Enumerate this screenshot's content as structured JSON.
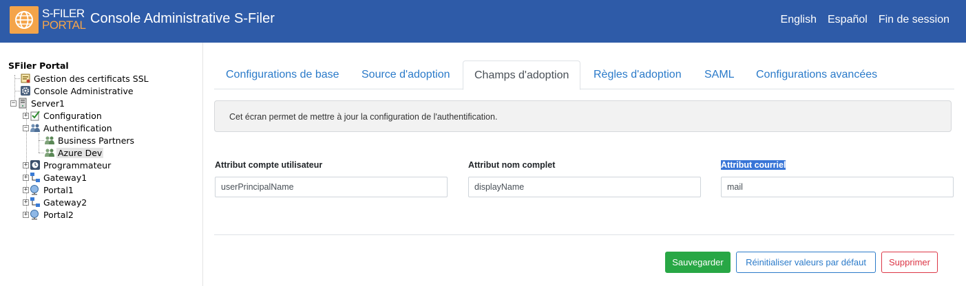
{
  "header": {
    "logo_line1": "S-FILER",
    "logo_line2": "PORTAL",
    "title": "Console Administrative S-Filer",
    "nav": [
      "English",
      "Español",
      "Fin de session"
    ],
    "colors": {
      "bar": "#2e5ba8",
      "accent": "#f4a44a"
    }
  },
  "sidebar": {
    "root": "SFiler Portal",
    "items": [
      {
        "label": "Gestion des certificats SSL",
        "icon": "certificate-icon"
      },
      {
        "label": "Console Administrative",
        "icon": "gear-icon"
      },
      {
        "label": "Server1",
        "icon": "server-icon",
        "expanded": true
      },
      {
        "label": "Configuration",
        "icon": "checklist-icon",
        "expanded": false
      },
      {
        "label": "Authentification",
        "icon": "users-icon",
        "expanded": true
      },
      {
        "label": "Business Partners",
        "icon": "users-icon"
      },
      {
        "label": "Azure Dev",
        "icon": "users-icon",
        "selected": true
      },
      {
        "label": "Programmateur",
        "icon": "clock-icon",
        "expanded": false
      },
      {
        "label": "Gateway1",
        "icon": "network-icon",
        "expanded": false
      },
      {
        "label": "Portal1",
        "icon": "globe-icon",
        "expanded": false
      },
      {
        "label": "Gateway2",
        "icon": "network-icon",
        "expanded": false
      },
      {
        "label": "Portal2",
        "icon": "globe-icon",
        "expanded": false
      }
    ]
  },
  "tabs": [
    {
      "label": "Configurations de base",
      "active": false
    },
    {
      "label": "Source d'adoption",
      "active": false
    },
    {
      "label": "Champs d'adoption",
      "active": true
    },
    {
      "label": "Règles d'adoption",
      "active": false
    },
    {
      "label": "SAML",
      "active": false
    },
    {
      "label": "Configurations avancées",
      "active": false
    }
  ],
  "info_text": "Cet écran permet de mettre à jour la configuration de l'authentification.",
  "fields": [
    {
      "label": "Attribut compte utilisateur",
      "value": "userPrincipalName"
    },
    {
      "label": "Attribut nom complet",
      "value": "displayName"
    },
    {
      "label": "Attribut courriel",
      "value": "mail",
      "label_highlighted": true
    }
  ],
  "buttons": {
    "save": "Sauvegarder",
    "reset": "Réinitialiser valeurs par défaut",
    "delete": "Supprimer"
  }
}
